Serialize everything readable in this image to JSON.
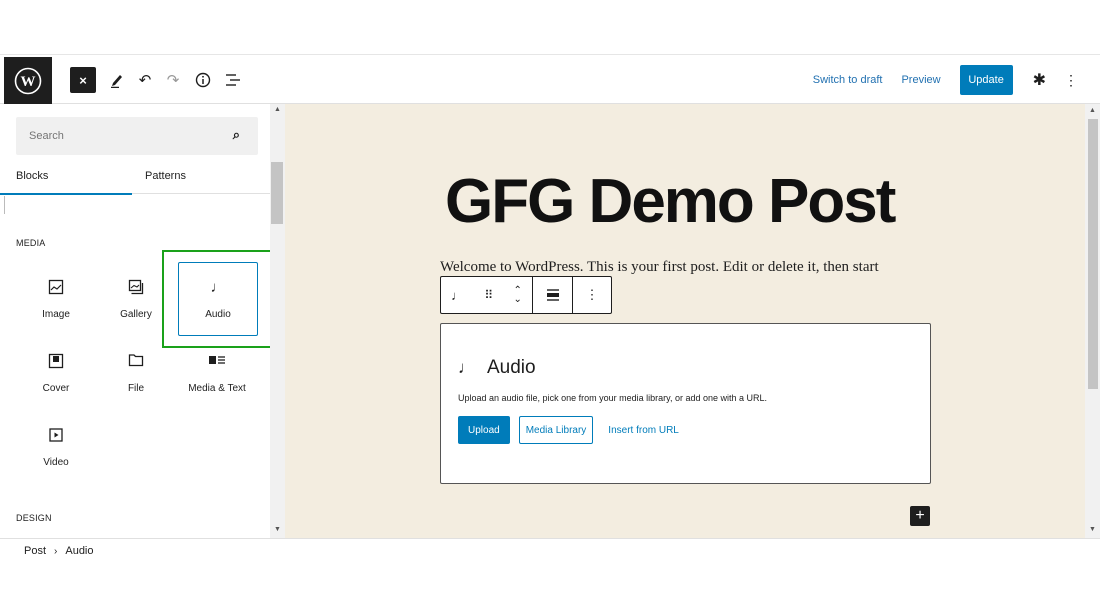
{
  "topbar": {
    "close_label": "×",
    "switch_to_draft": "Switch to draft",
    "preview": "Preview",
    "update": "Update"
  },
  "inserter": {
    "search_placeholder": "Search",
    "tabs": [
      "Blocks",
      "Patterns"
    ],
    "active_tab": "Blocks",
    "categories": {
      "media": "MEDIA",
      "design": "DESIGN"
    },
    "media_blocks": [
      {
        "label": "Image",
        "icon": "image-icon"
      },
      {
        "label": "Gallery",
        "icon": "gallery-icon"
      },
      {
        "label": "Audio",
        "icon": "audio-icon",
        "selected": true
      },
      {
        "label": "Cover",
        "icon": "cover-icon"
      },
      {
        "label": "File",
        "icon": "file-icon"
      },
      {
        "label": "Media & Text",
        "icon": "media-text-icon"
      },
      {
        "label": "Video",
        "icon": "video-icon"
      }
    ]
  },
  "editor": {
    "post_title": "GFG Demo Post",
    "paragraph": "Welcome to WordPress. This is your first post. Edit or delete it, then start",
    "audio_block": {
      "title": "Audio",
      "description": "Upload an audio file, pick one from your media library, or add one with a URL.",
      "upload": "Upload",
      "media_library": "Media Library",
      "insert_from_url": "Insert from URL"
    }
  },
  "breadcrumb": [
    "Post",
    "Audio"
  ],
  "colors": {
    "accent": "#007cba",
    "canvas_bg": "#f3ede0",
    "highlight": "#1aa11a",
    "dark": "#1e1e1e"
  }
}
